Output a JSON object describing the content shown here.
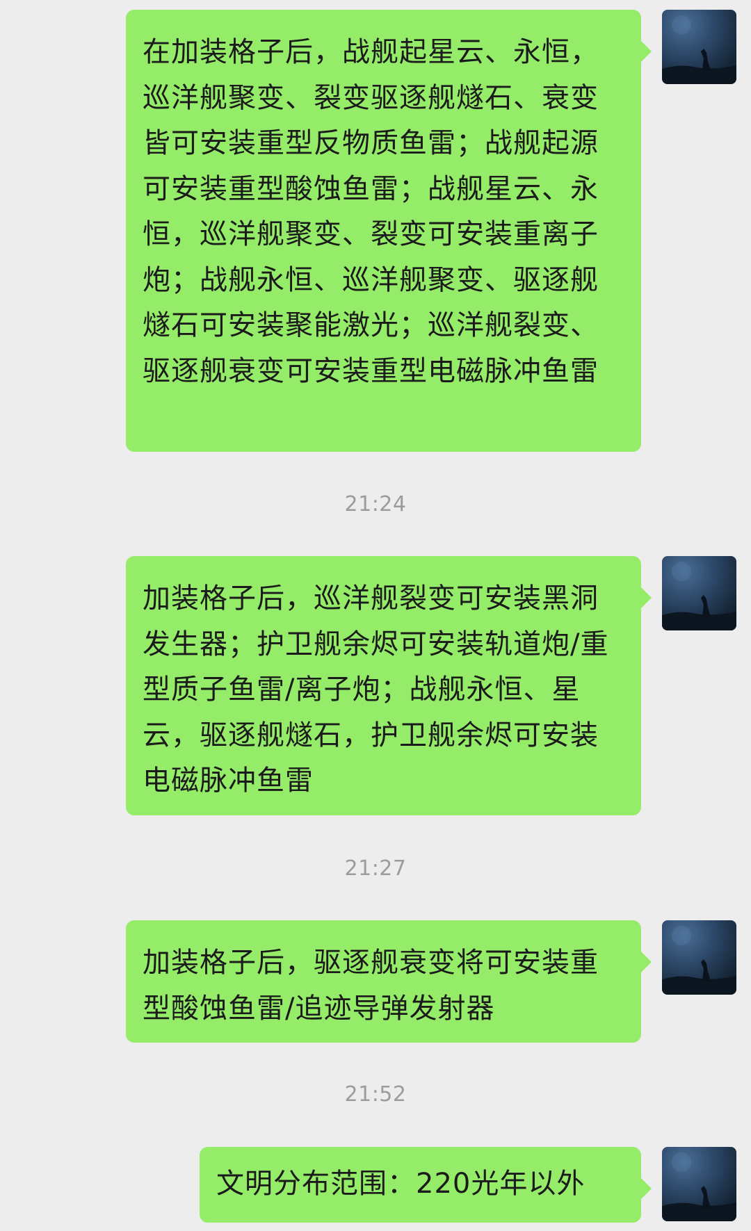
{
  "messages": [
    {
      "text": "在加装格子后，战舰起星云、永恒，巡洋舰聚变、裂变驱逐舰燧石、衰变皆可安装重型反物质鱼雷；战舰起源可安装重型酸蚀鱼雷；战舰星云、永恒，巡洋舰聚变、裂变可安装重离子炮；战舰永恒、巡洋舰聚变、驱逐舰燧石可安装聚能激光；巡洋舰裂变、驱逐舰衰变可安装重型电磁脉冲鱼雷",
      "sender": "self"
    },
    {
      "time": "21:24"
    },
    {
      "text": "加装格子后，巡洋舰裂变可安装黑洞发生器；护卫舰余烬可安装轨道炮/重型质子鱼雷/离子炮；战舰永恒、星云，驱逐舰燧石，护卫舰余烬可安装电磁脉冲鱼雷",
      "sender": "self"
    },
    {
      "time": "21:27"
    },
    {
      "text": "加装格子后，驱逐舰衰变将可安装重型酸蚀鱼雷/追迹导弹发射器",
      "sender": "self"
    },
    {
      "time": "21:52"
    },
    {
      "text": "文明分布范围：220光年以外",
      "sender": "self"
    }
  ],
  "colors": {
    "background": "#ededed",
    "bubble": "#95ec69",
    "timestamp": "#9c9c9c"
  },
  "icons": {
    "avatar": "night-sky-wolf-avatar"
  }
}
